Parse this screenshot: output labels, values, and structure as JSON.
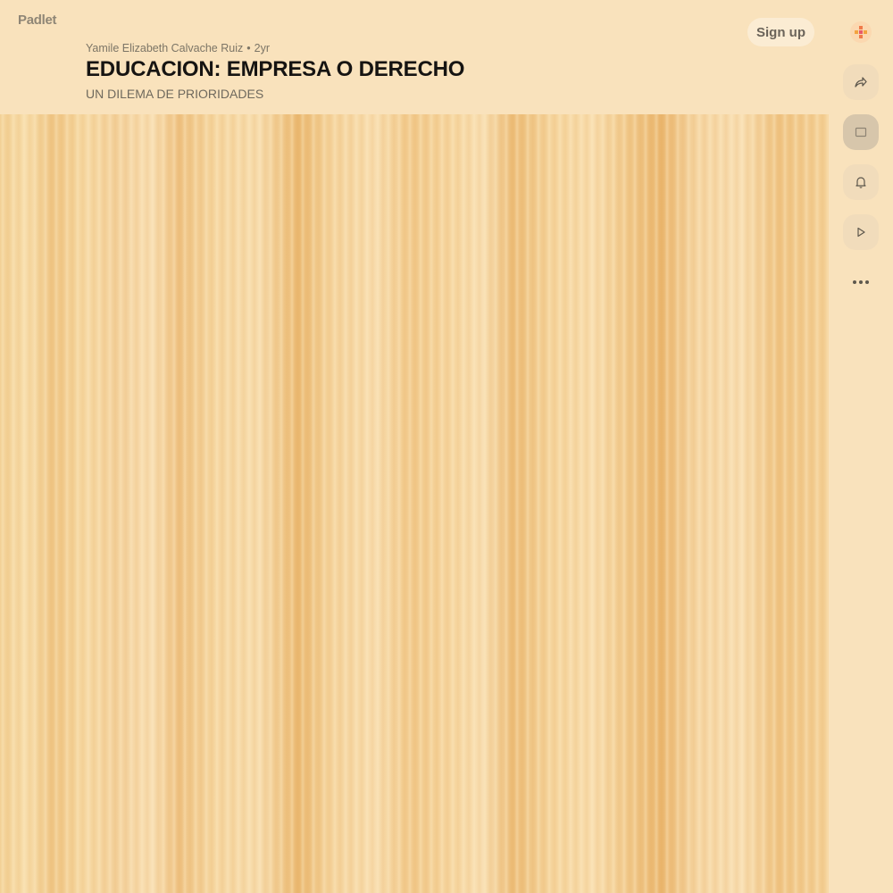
{
  "app": {
    "logo_text": "Padlet"
  },
  "header": {
    "author": "Yamile Elizabeth Calvache Ruiz",
    "separator": "•",
    "age": "2yr",
    "title": "EDUCACION: EMPRESA O DERECHO",
    "subtitle": "UN DILEMA DE PRIORIDADES",
    "signup_label": "Sign up"
  },
  "rail": {
    "icons": [
      "share-icon",
      "remake-icon",
      "bell-icon",
      "play-icon",
      "more-icon"
    ]
  },
  "colors": {
    "background": "#f9e2bc",
    "board_wood": "#f2cf93",
    "title_text": "#161412",
    "avatar_accent": "#f07a4a"
  }
}
